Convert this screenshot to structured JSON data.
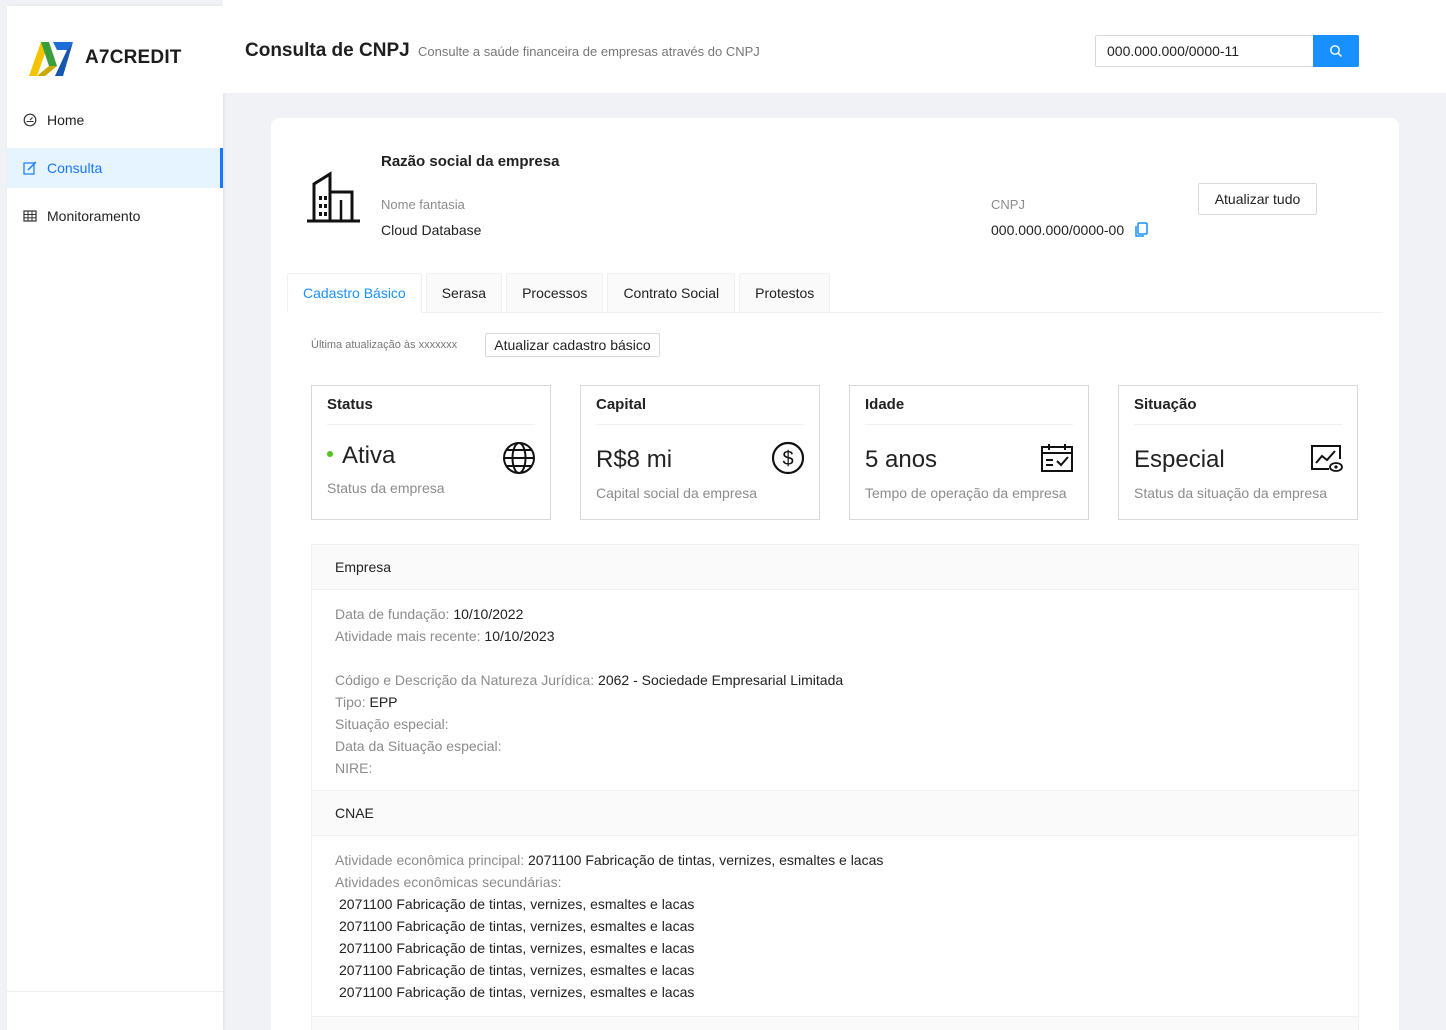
{
  "brand": {
    "name": "A7CREDIT",
    "colors": {
      "yellow": "#f5c400",
      "blue": "#1c6fd8",
      "green": "#3a9e3a"
    }
  },
  "sidebar": {
    "items": [
      {
        "label": "Home",
        "icon": "dashboard-icon",
        "active": false
      },
      {
        "label": "Consulta",
        "icon": "edit-icon",
        "active": true
      },
      {
        "label": "Monitoramento",
        "icon": "table-icon",
        "active": false
      }
    ]
  },
  "header": {
    "title": "Consulta de CNPJ",
    "subtitle": "Consulte a saúde financeira de empresas através do CNPJ",
    "search": {
      "value": "000.000.000/0000-11",
      "placeholder": "",
      "icon": "search-icon"
    }
  },
  "company": {
    "razao_social": "Razão social da empresa",
    "nome_fantasia_label": "Nome fantasia",
    "nome_fantasia": "Cloud Database",
    "cnpj_label": "CNPJ",
    "cnpj": "000.000.000/0000-00",
    "update_all_label": "Atualizar tudo",
    "icon": "building-icon"
  },
  "tabs": [
    {
      "label": "Cadastro Básico",
      "active": true
    },
    {
      "label": "Serasa",
      "active": false
    },
    {
      "label": "Processos",
      "active": false
    },
    {
      "label": "Contrato Social",
      "active": false
    },
    {
      "label": "Protestos",
      "active": false
    }
  ],
  "basic": {
    "last_update": "Última atualização às xxxxxxx",
    "update_button": "Atualizar cadastro básico"
  },
  "stats": [
    {
      "title": "Status",
      "value": "Ativa",
      "desc": "Status da empresa",
      "icon": "globe-icon",
      "status_color": "#52c41a"
    },
    {
      "title": "Capital",
      "value": "R$8 mi",
      "desc": "Capital social da empresa",
      "icon": "dollar-circle-icon"
    },
    {
      "title": "Idade",
      "value": "5 anos",
      "desc": "Tempo de operação da empresa",
      "icon": "calendar-check-icon"
    },
    {
      "title": "Situação",
      "value": "Especial",
      "desc": "Status da situação da empresa",
      "icon": "chart-eye-icon"
    }
  ],
  "empresa": {
    "heading": "Empresa",
    "fundacao_label": "Data de fundação:",
    "fundacao": "10/10/2022",
    "atividade_label": "Atividade mais recente:",
    "atividade": "10/10/2023",
    "natureza_label": "Código e Descrição da Natureza Jurídica:",
    "natureza": "2062 - Sociedade Empresarial Limitada",
    "tipo_label": "Tipo:",
    "tipo": "EPP",
    "situacao_label": "Situação especial:",
    "situacao": "",
    "data_situacao_label": "Data da Situação especial:",
    "data_situacao": "",
    "nire_label": "NIRE:",
    "nire": ""
  },
  "cnae": {
    "heading": "CNAE",
    "principal_label": "Atividade econômica principal:",
    "principal": "2071100 Fabricação de tintas, vernizes, esmaltes e lacas",
    "secundarias_label": "Atividades econômicas secundárias:",
    "secundarias": [
      "2071100 Fabricação de tintas, vernizes, esmaltes e lacas",
      "2071100 Fabricação de tintas, vernizes, esmaltes e lacas",
      "2071100 Fabricação de tintas, vernizes, esmaltes e lacas",
      "2071100 Fabricação de tintas, vernizes, esmaltes e lacas",
      "2071100 Fabricação de tintas, vernizes, esmaltes e lacas"
    ]
  }
}
